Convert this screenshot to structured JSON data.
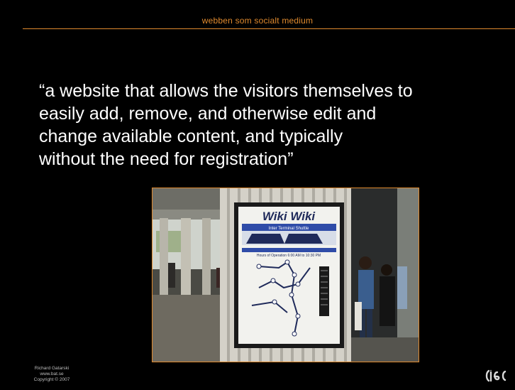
{
  "slide": {
    "header_title": "webben som socialt medium",
    "quote_lines": [
      "“a website that allows the visitors themselves to",
      "easily add, remove, and otherwise edit and",
      "change available content, and typically",
      "without the need for registration”"
    ],
    "photo": {
      "sign_title": "Wiki Wiki",
      "sign_subtitle": "Inter Terminal Shuttle",
      "sign_hours": "Hours of Operation 6:00 AM to 10:30 PM"
    },
    "footer": {
      "author": "Richard Gatarski",
      "website": "www.bat.se",
      "copyright": "Copyright © 2007"
    }
  },
  "colors": {
    "accent": "#e08a2e",
    "background": "#000000",
    "text": "#ffffff"
  }
}
